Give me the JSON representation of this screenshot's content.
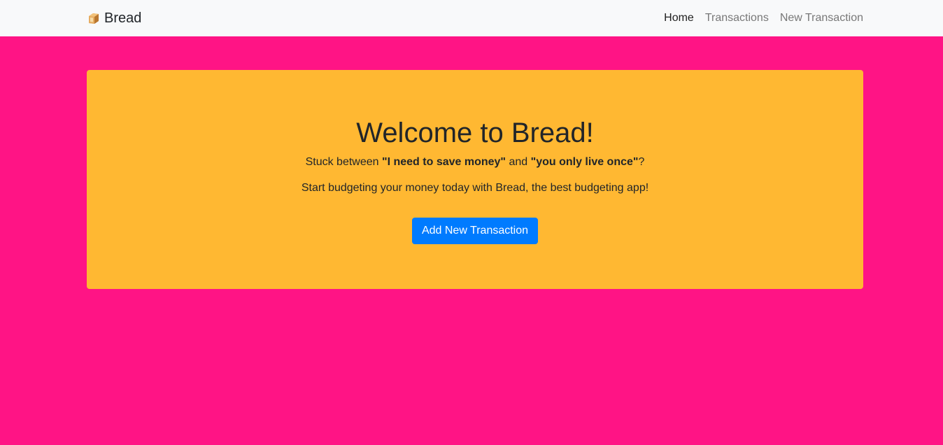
{
  "navbar": {
    "brand_label": "Bread",
    "brand_icon": "bread-icon",
    "links": [
      {
        "label": "Home",
        "active": true
      },
      {
        "label": "Transactions",
        "active": false
      },
      {
        "label": "New Transaction",
        "active": false
      }
    ]
  },
  "hero": {
    "title": "Welcome to Bread!",
    "line1_prefix": "Stuck between ",
    "line1_quote1": "\"I need to save money\"",
    "line1_mid": " and ",
    "line1_quote2": "\"you only live once\"",
    "line1_suffix": "?",
    "line2": "Start budgeting your money today with Bread, the best budgeting app!",
    "button_label": "Add New Transaction"
  },
  "colors": {
    "page_background": "#ff1485",
    "navbar_background": "#f8f9fa",
    "hero_background": "#ffb832",
    "button_background": "#007bff"
  }
}
